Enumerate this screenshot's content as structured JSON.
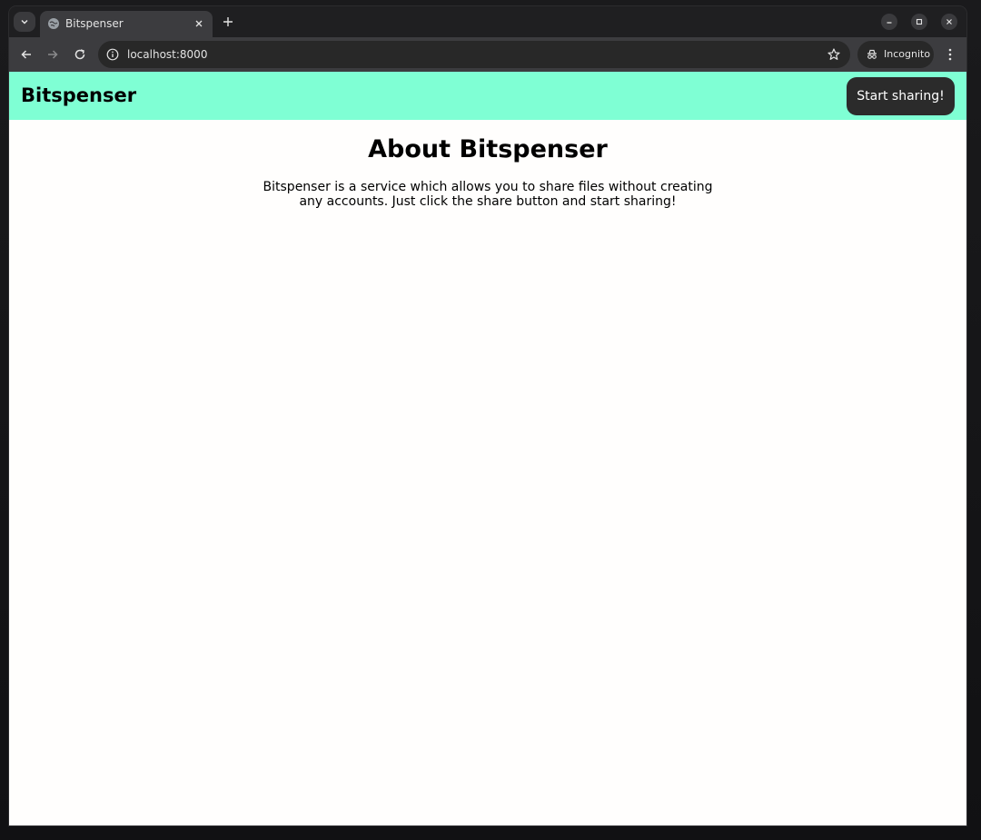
{
  "browser": {
    "tab": {
      "title": "Bitspenser"
    },
    "address_bar": {
      "url": "localhost:8000"
    },
    "profile": {
      "label": "Incognito"
    }
  },
  "site": {
    "header": {
      "logo": "Bitspenser",
      "cta_label": "Start sharing!"
    },
    "main": {
      "title": "About Bitspenser",
      "description": "Bitspenser is a service which allows you to share files without creating any accounts. Just click the share button and start sharing!"
    }
  },
  "colors": {
    "header_bg": "#7fffd4",
    "cta_bg": "#2b2b2b",
    "page_bg": "#fffefd"
  }
}
